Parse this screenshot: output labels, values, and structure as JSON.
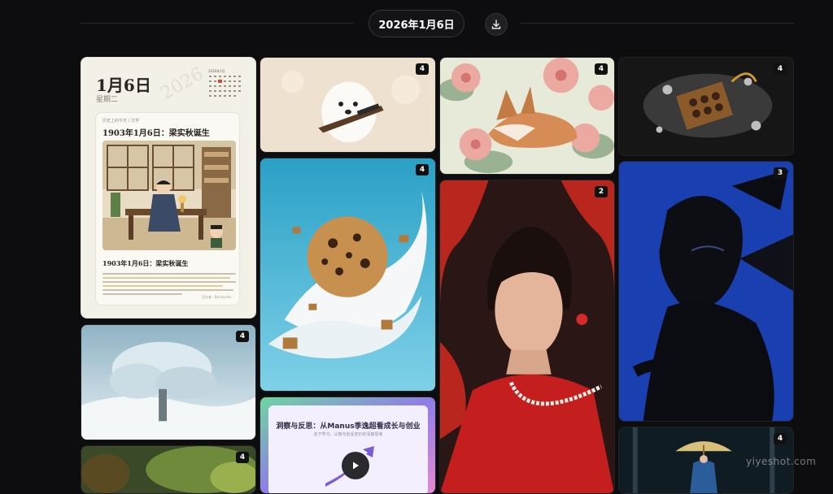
{
  "header": {
    "date_label": "2026年1月6日",
    "download_icon": "download-icon"
  },
  "calendar_card": {
    "day_title": "1月6日",
    "weekday": "星期二",
    "year_watermark": "2026",
    "mini_calendar_title": "2026年1月",
    "source_line": "历史上的今天丨文学",
    "headline": "1903年1月6日：梁实秋诞生",
    "subheadline": "1903年1月6日：梁实秋诞生",
    "footer": "设计者 · Bennyoda"
  },
  "cards": [
    {
      "name": "puppy-card",
      "count": "4"
    },
    {
      "name": "fox-card",
      "count": "4"
    },
    {
      "name": "chocolate-card",
      "count": "4"
    },
    {
      "name": "cookie-card",
      "count": "4"
    },
    {
      "name": "woman-card",
      "count": "2"
    },
    {
      "name": "portrait-card",
      "count": "3"
    },
    {
      "name": "snow-tree-card",
      "count": "4"
    },
    {
      "name": "forest-card",
      "count": "4"
    },
    {
      "name": "umbrella-card",
      "count": "4"
    }
  ],
  "video_card": {
    "title": "洞察与反思：从Manus季逸超看成长与创业",
    "subtitle": "关于学习、认知与创业定价的深度思考",
    "play_icon": "play-icon"
  },
  "watermark": "yiyeshot.com"
}
